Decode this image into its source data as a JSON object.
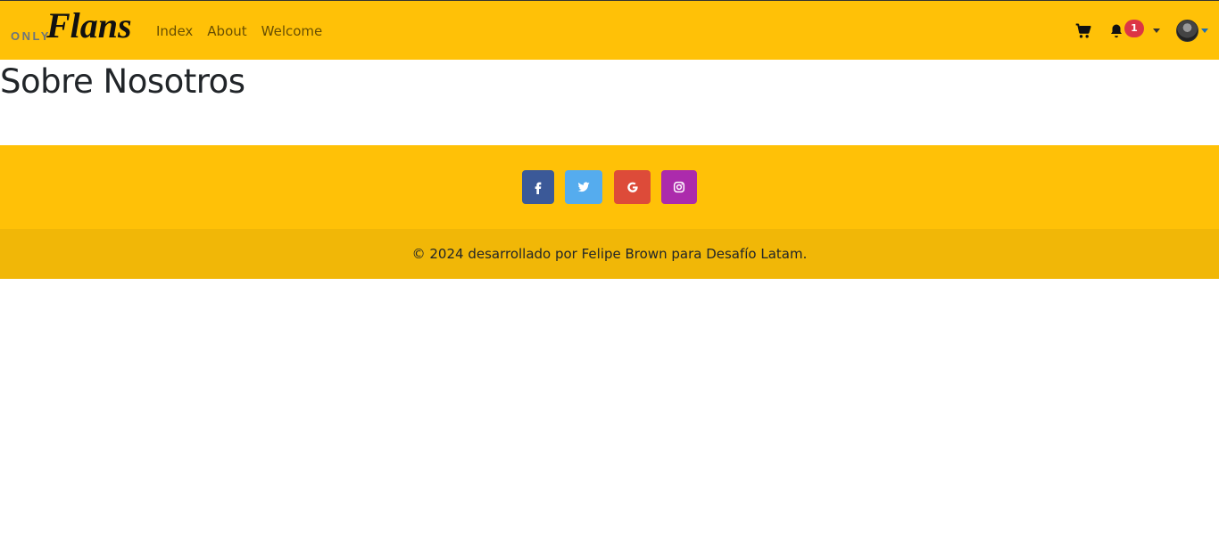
{
  "navbar": {
    "brand": {
      "small": "ONLY",
      "script": "Flans"
    },
    "links": [
      "Index",
      "About",
      "Welcome"
    ],
    "cart_icon": "cart-icon",
    "bell_icon": "bell-icon",
    "notification_count": "1"
  },
  "main": {
    "title": "Sobre Nosotros"
  },
  "footer": {
    "social": [
      {
        "icon": "facebook-icon",
        "color": "#3b5998"
      },
      {
        "icon": "twitter-icon",
        "color": "#55acee"
      },
      {
        "icon": "google-icon",
        "color": "#dd4b39"
      },
      {
        "icon": "instagram-icon",
        "color": "#ac2bac"
      }
    ],
    "copyright": "© 2024 desarrollado por Felipe Brown para Desafío Latam."
  },
  "colors": {
    "primary": "#ffc107",
    "footer_bottom": "#f1b707",
    "badge": "#dc3545"
  }
}
